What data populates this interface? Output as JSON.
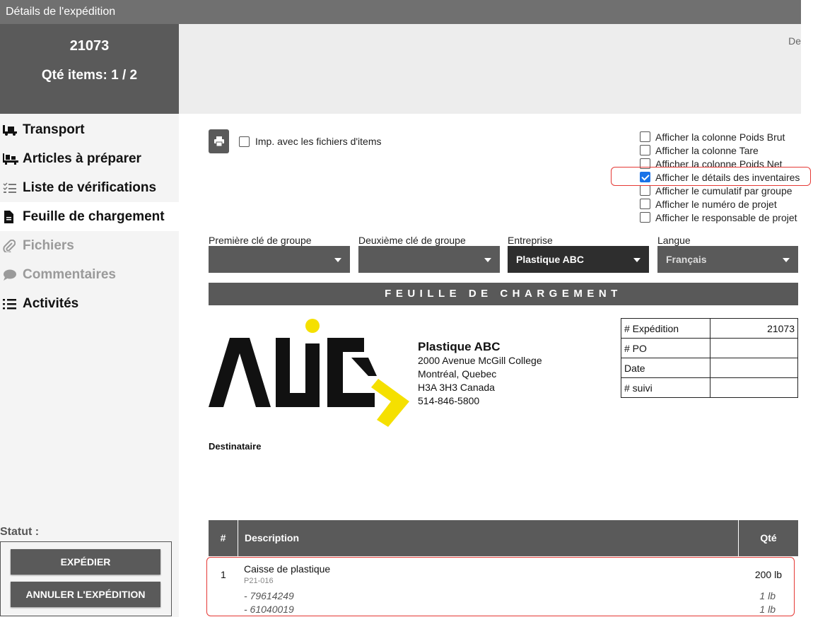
{
  "window": {
    "title": "Détails de l'expédition"
  },
  "summary": {
    "number": "21073",
    "qty": "Qté items: 1 / 2"
  },
  "top_right_hint": "De",
  "nav": [
    {
      "label": "Transport",
      "icon": "truck-icon"
    },
    {
      "label": "Articles à préparer",
      "icon": "pallet-icon"
    },
    {
      "label": "Liste de vérifications",
      "icon": "checklist-icon"
    },
    {
      "label": "Feuille de chargement",
      "icon": "document-icon"
    },
    {
      "label": "Fichiers",
      "icon": "paperclip-icon"
    },
    {
      "label": "Commentaires",
      "icon": "comment-icon"
    },
    {
      "label": "Activités",
      "icon": "list-icon"
    }
  ],
  "status": {
    "label": "Statut :",
    "ship_button": "EXPÉDIER",
    "cancel_button": "ANNULER L'EXPÉDITION"
  },
  "print": {
    "with_files_label": "Imp. avec les fichiers d'items",
    "with_files_checked": false
  },
  "options": [
    {
      "label": "Afficher la colonne Poids Brut",
      "checked": false
    },
    {
      "label": "Afficher la colonne Tare",
      "checked": false
    },
    {
      "label": "Afficher la colonne Poids Net",
      "checked": false
    },
    {
      "label": "Afficher le détails des inventaires",
      "checked": true
    },
    {
      "label": "Afficher le cumulatif par groupe",
      "checked": false
    },
    {
      "label": "Afficher le numéro de projet",
      "checked": false
    },
    {
      "label": "Afficher le responsable de projet",
      "checked": false
    }
  ],
  "selects": {
    "group1": {
      "label": "Première clé de groupe",
      "value": ""
    },
    "group2": {
      "label": "Deuxième clé de groupe",
      "value": ""
    },
    "company": {
      "label": "Entreprise",
      "value": "Plastique ABC"
    },
    "language": {
      "label": "Langue",
      "value": "Français"
    }
  },
  "sheet": {
    "title": "FEUILLE DE CHARGEMENT",
    "company": {
      "name": "Plastique ABC",
      "address1": "2000 Avenue McGill College",
      "address2": "Montréal, Quebec",
      "address3": "H3A 3H3 Canada",
      "phone": "514-846-5800"
    },
    "info": [
      {
        "key": "# Expédition",
        "value": "21073"
      },
      {
        "key": "# PO",
        "value": ""
      },
      {
        "key": "Date",
        "value": ""
      },
      {
        "key": "# suivi",
        "value": ""
      }
    ],
    "recipient_label": "Destinataire",
    "table": {
      "headers": {
        "num": "#",
        "description": "Description",
        "qty": "Qté"
      },
      "rows": [
        {
          "num": "1",
          "description": "Caisse de plastique",
          "code": "P21-016",
          "qty": "200 lb",
          "inventory": [
            {
              "id": "- 79614249",
              "qty": "1 lb"
            },
            {
              "id": "- 61040019",
              "qty": "1 lb"
            }
          ]
        }
      ]
    }
  },
  "colors": {
    "accent": "#5a5a5a",
    "highlight": "#e53935",
    "logo_yellow": "#f5e000"
  }
}
